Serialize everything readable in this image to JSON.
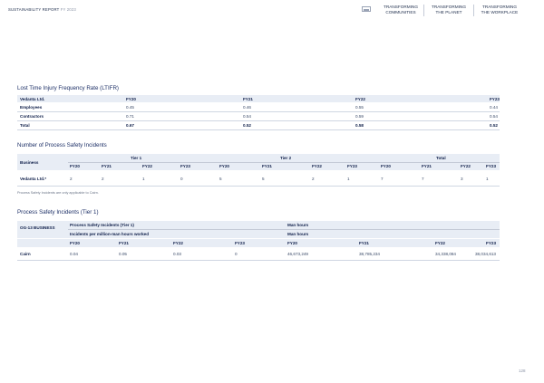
{
  "header": {
    "report_label": "SUSTAINABILITY REPORT",
    "report_year": "FY 2023",
    "tabs": [
      {
        "line1": "TRANSFORMING",
        "line2": "COMMUNITIES"
      },
      {
        "line1": "TRANSFORMING",
        "line2": "THE PLANET"
      },
      {
        "line1": "TRANSFORMING",
        "line2": "THE WORKPLACE"
      }
    ]
  },
  "ltifr": {
    "title": "Lost Time Injury Frequency Rate (LTIFR)",
    "columns": [
      "Vedanta Ltd.",
      "FY20",
      "FY21",
      "FY22",
      "FY23"
    ],
    "rows": [
      [
        "Employees",
        "0.45",
        "0.46",
        "0.55",
        "0.44"
      ],
      [
        "Contractors",
        "0.71",
        "0.54",
        "0.59",
        "0.54"
      ],
      [
        "Total",
        "0.67",
        "0.52",
        "0.58",
        "0.52"
      ]
    ]
  },
  "psi": {
    "title": "Number of Process Safety Incidents",
    "group_headers": [
      "Tier 1",
      "Tier 2",
      "Total"
    ],
    "business_label": "Business",
    "years": [
      "FY20",
      "FY21",
      "FY22",
      "FY23",
      "FY20",
      "FY21",
      "FY22",
      "FY23",
      "FY20",
      "FY21",
      "FY22",
      "FY23"
    ],
    "row_label": "Vedanta Ltd.*",
    "values": [
      "2",
      "2",
      "1",
      "0",
      "5",
      "5",
      "2",
      "1",
      "7",
      "7",
      "3",
      "1"
    ],
    "note": "Process Safety Incidents are only applicable to Cairn."
  },
  "tier1": {
    "title": "Process Safety Incidents (Tier 1)",
    "og_label": "OG-13 BUSINESS",
    "sub_left_1": "Process Safety Incidents (Tier 1)",
    "sub_left_2": "Incidents per million-man hours worked",
    "sub_right_1": "Man hours",
    "sub_right_2": "Man hours",
    "years": [
      "FY20",
      "FY21",
      "FY22",
      "FY23",
      "FY20",
      "FY21",
      "FY22",
      "FY23"
    ],
    "row_label": "Cairn",
    "values": [
      "0.04",
      "0.05",
      "0.03",
      "0",
      "46,673,249",
      "38,785,234",
      "34,338,084",
      "38,034,613"
    ]
  },
  "page_number": "128"
}
